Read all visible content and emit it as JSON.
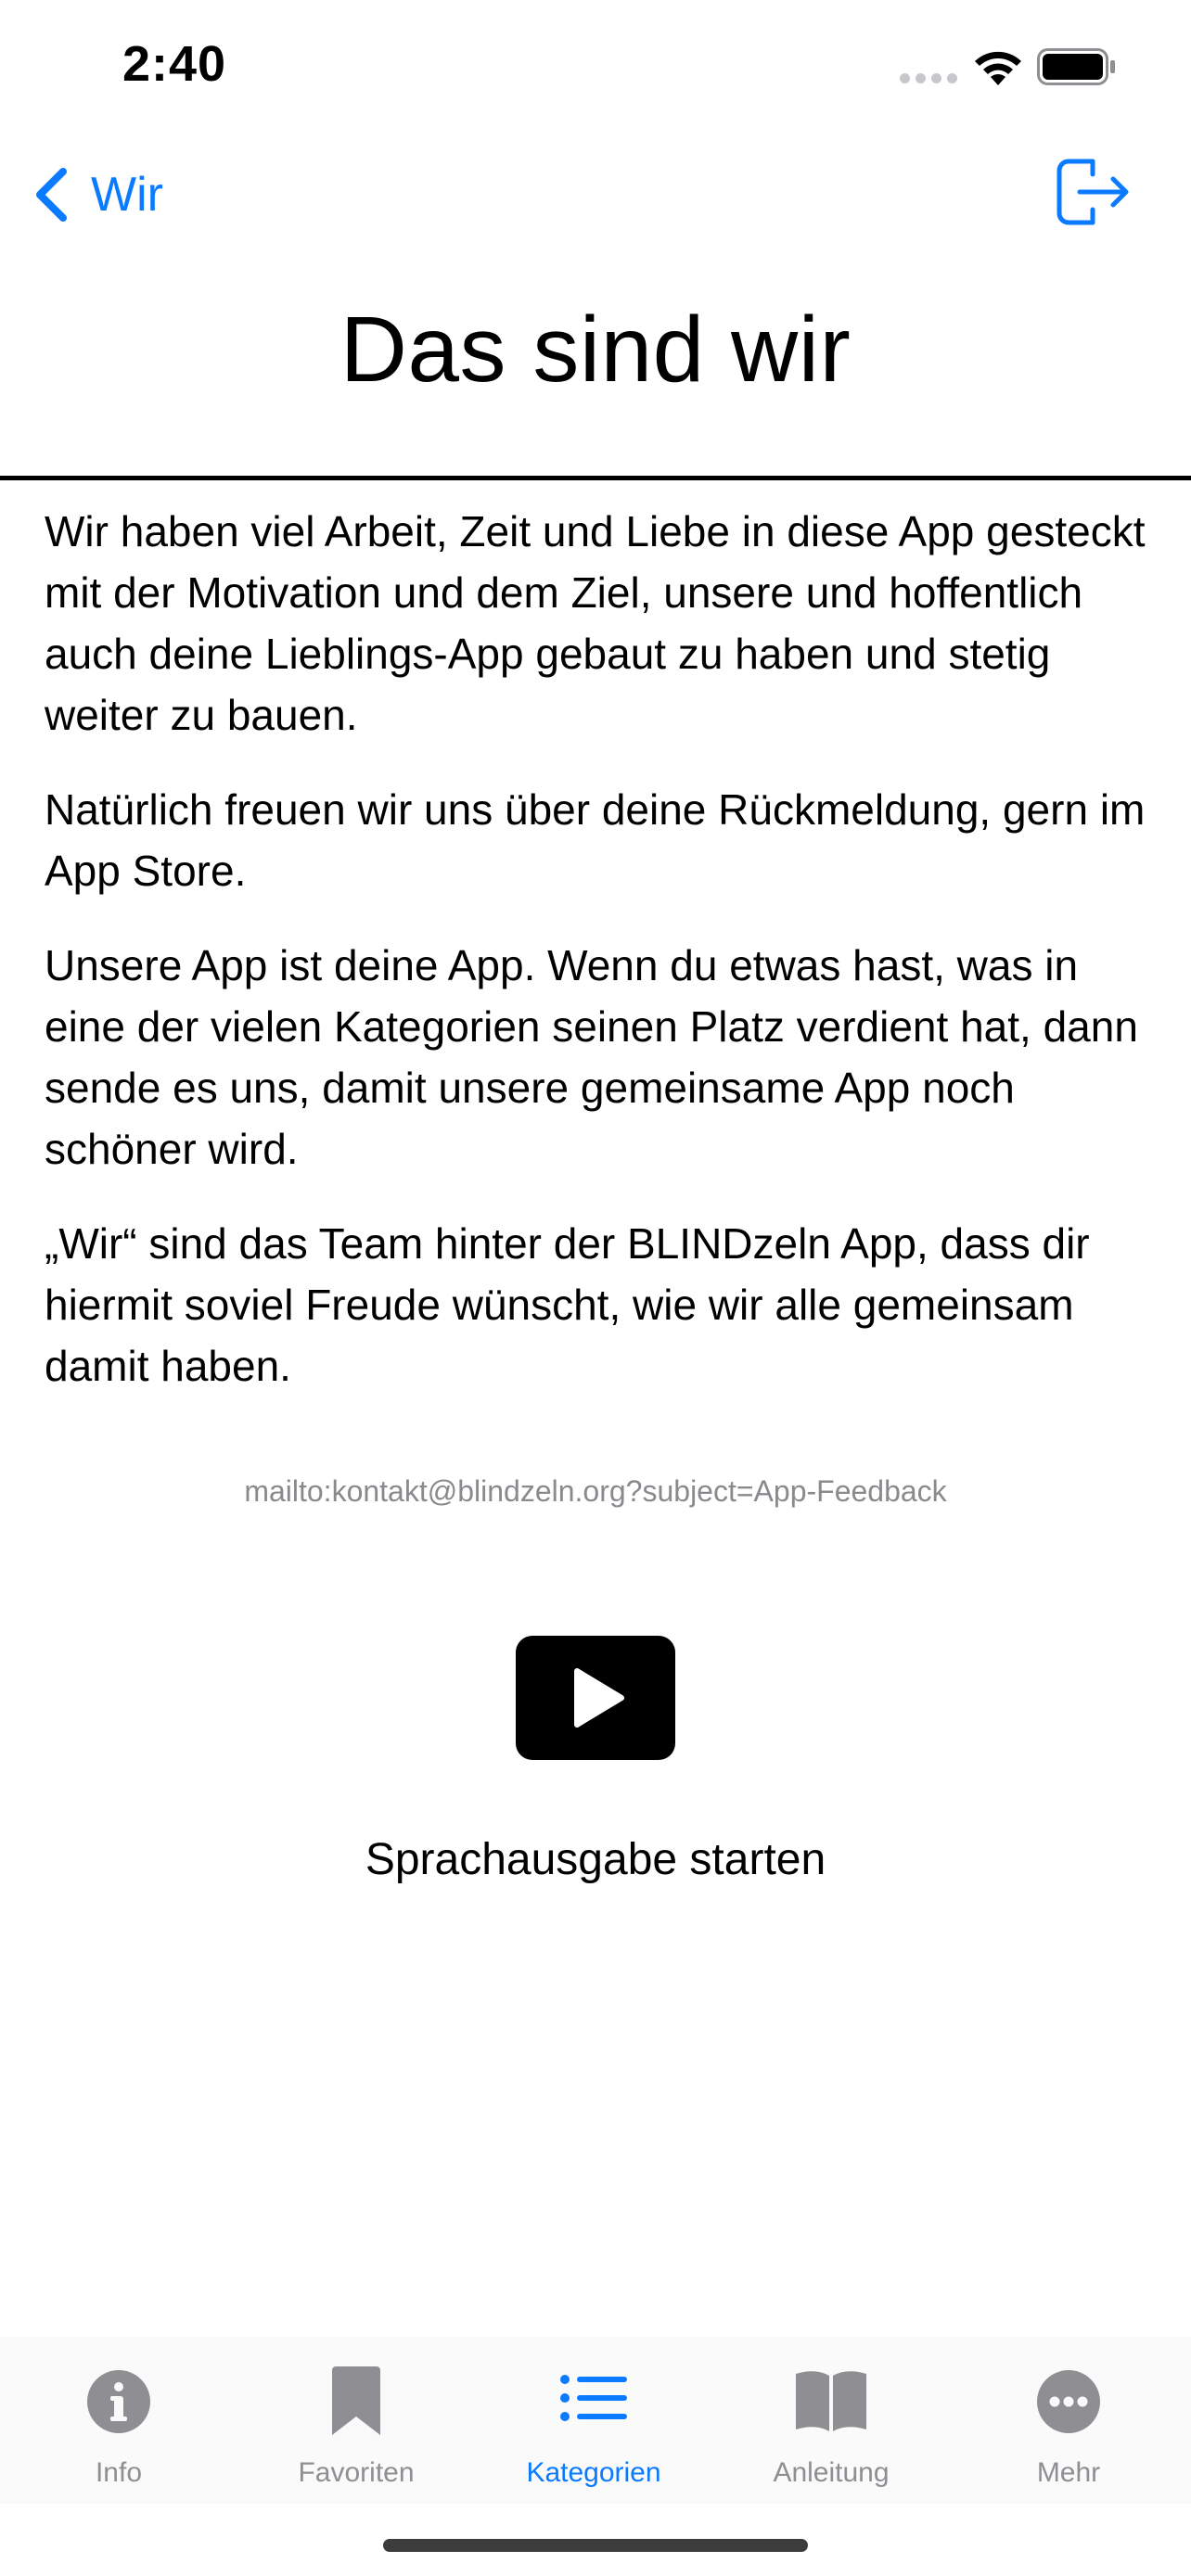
{
  "status_bar": {
    "time": "2:40"
  },
  "nav": {
    "back_label": "Wir",
    "back_icon": "chevron-left-icon",
    "logout_icon": "logout-icon"
  },
  "page": {
    "title": "Das sind wir",
    "paragraphs": [
      "Wir haben viel Arbeit, Zeit und Liebe in diese App gesteckt mit der Motivation und dem Ziel, unsere und hoffentlich auch deine Lieblings-App gebaut zu haben und stetig weiter zu bauen.",
      "Natürlich freuen wir uns über deine Rückmeldung, gern im App Store.",
      "Unsere App ist deine App. Wenn du etwas hast, was in eine der vielen Kategorien seinen Platz verdient hat, dann sende es uns, damit unsere gemeinsame App noch schöner wird.",
      "„Wir“ sind das Team hinter der BLINDzeln App, dass dir hiermit soviel Freude wünscht, wie wir alle gemeinsam damit haben."
    ],
    "mailto": "mailto:kontakt@blindzeln.org?subject=App-Feedback",
    "play_label": "Sprachausgabe starten"
  },
  "tabs": [
    {
      "label": "Info",
      "icon": "info-icon",
      "active": false
    },
    {
      "label": "Favoriten",
      "icon": "bookmark-icon",
      "active": false
    },
    {
      "label": "Kategorien",
      "icon": "list-icon",
      "active": true
    },
    {
      "label": "Anleitung",
      "icon": "book-icon",
      "active": false
    },
    {
      "label": "Mehr",
      "icon": "more-icon",
      "active": false
    }
  ],
  "colors": {
    "accent": "#0a7aff",
    "inactive_tab": "#8e8e93",
    "link_gray": "#8a8a8e"
  }
}
